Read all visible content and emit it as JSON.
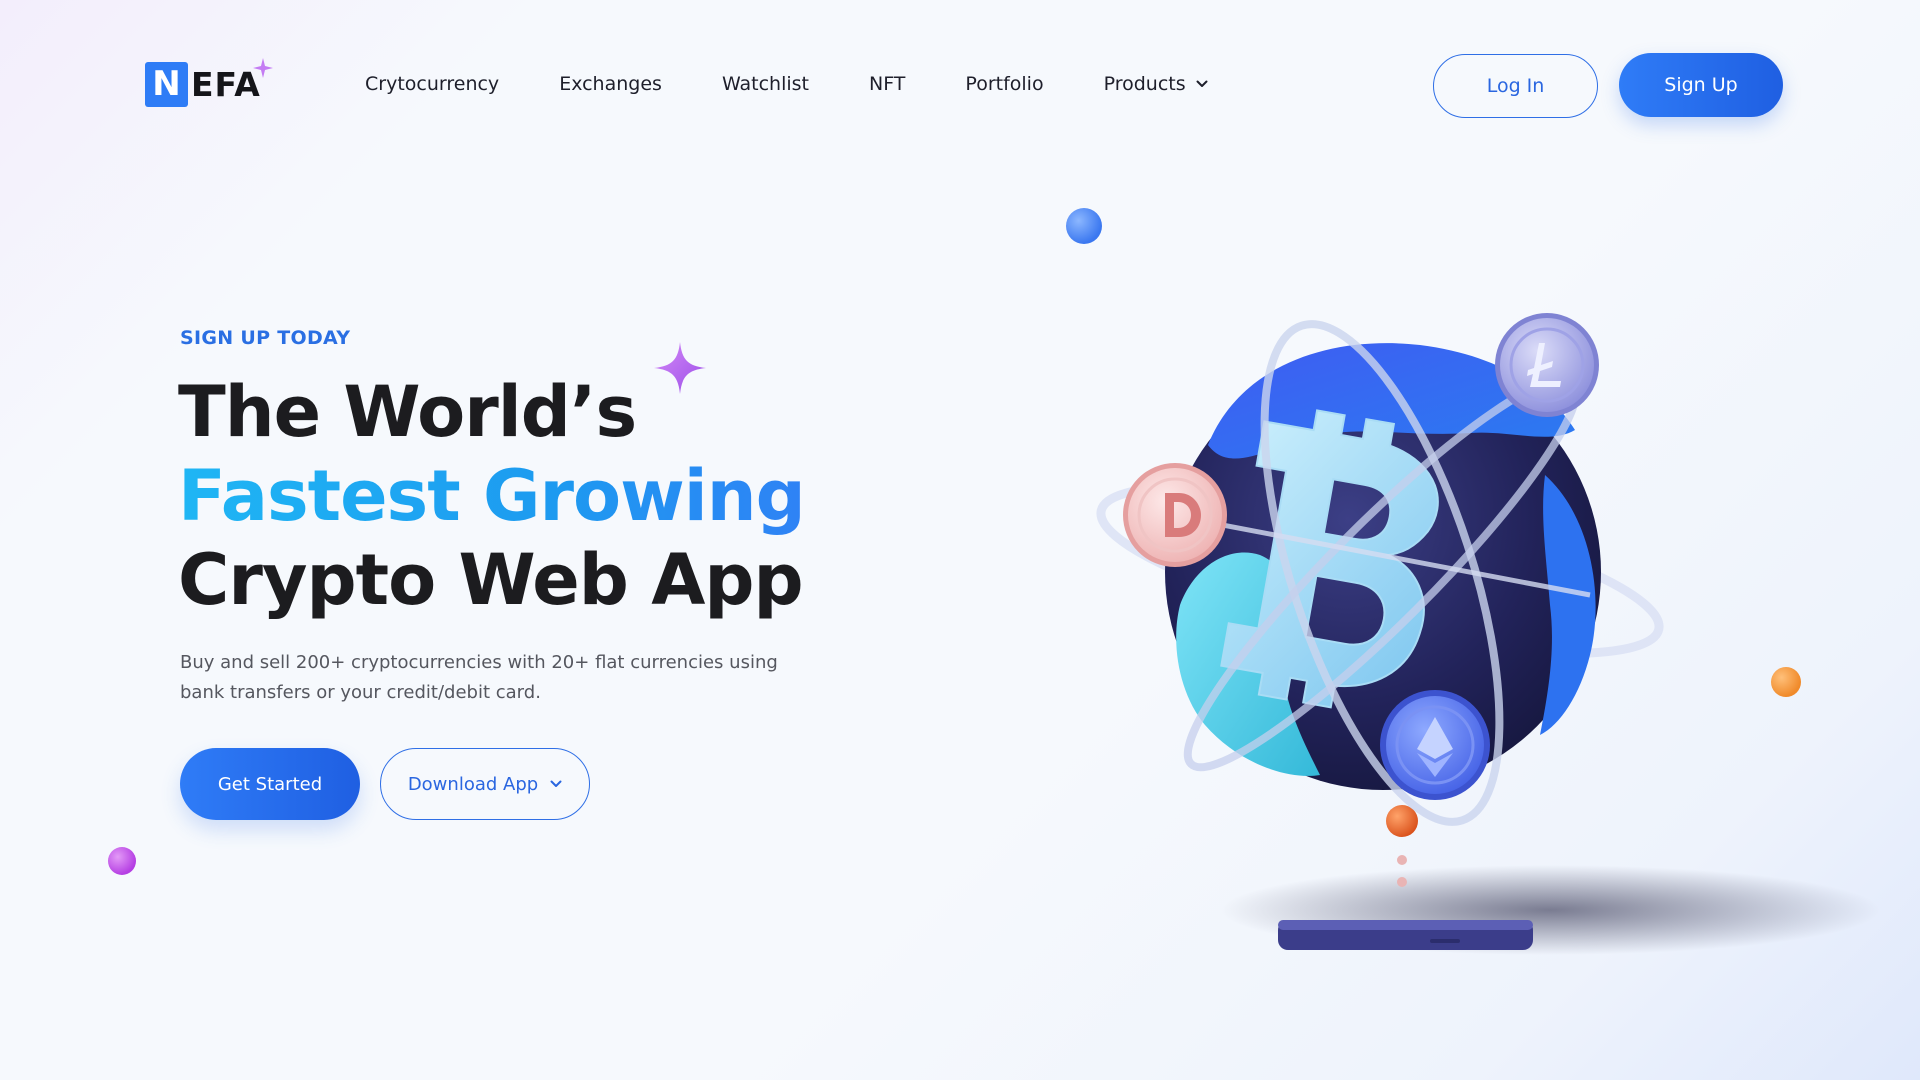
{
  "brand": {
    "logo_letter": "N",
    "logo_text": "EFA",
    "accent_color": "#2e7cf6"
  },
  "nav": {
    "items": [
      {
        "label": "Crytocurrency"
      },
      {
        "label": "Exchanges"
      },
      {
        "label": "Watchlist"
      },
      {
        "label": "NFT"
      },
      {
        "label": "Portfolio"
      },
      {
        "label": "Products",
        "icon": "chevron-down-icon"
      }
    ]
  },
  "auth": {
    "login_label": "Log In",
    "signup_label": "Sign Up"
  },
  "hero": {
    "eyebrow": "SIGN UP TODAY",
    "headline_line1": "The World’s",
    "headline_line2": "Fastest Growing",
    "headline_line3": "Crypto Web App",
    "subtext": "Buy and sell 200+ cryptocurrencies with 20+ flat currencies using bank transfers or your credit/debit card.",
    "primary_cta": "Get Started",
    "secondary_cta": "Download App",
    "secondary_cta_icon": "chevron-down-icon"
  },
  "illustration": {
    "subject": "globe-with-bitcoin-icon",
    "orbiting_coins": [
      "litecoin-icon",
      "dogecoin-icon",
      "ethereum-icon"
    ],
    "platform": "phone-platform"
  },
  "colors": {
    "primary": "#2f7cf7",
    "gradient_text": "#1fb6f4",
    "dark_text": "#1c1c1f",
    "star": "#b46cf0",
    "dot_purple": "#c04fe8",
    "dot_blue": "#3b78f0",
    "dot_orange": "#f08a2a"
  }
}
